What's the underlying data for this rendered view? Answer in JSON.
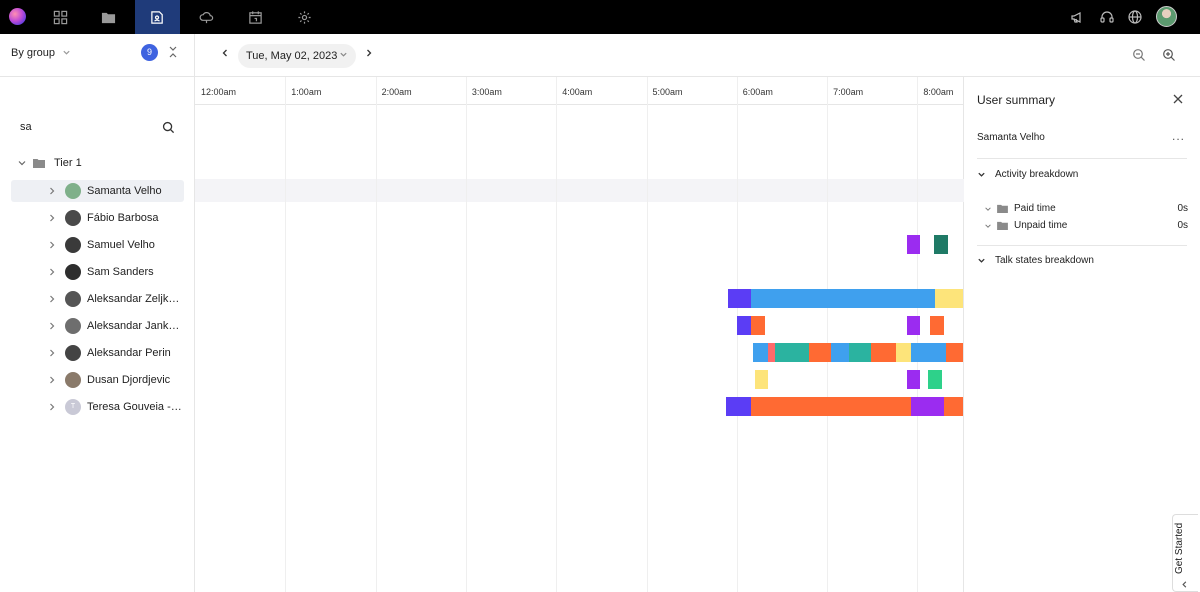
{
  "nav": {
    "items": [
      "dashboard-icon",
      "folder-icon",
      "people-icon",
      "cloud-icon",
      "calendar-icon",
      "settings-icon"
    ],
    "active_index": 2,
    "right_icons": [
      "megaphone-icon",
      "headset-icon",
      "globe-icon"
    ]
  },
  "toolbar": {
    "date": "Tue, May 02, 2023"
  },
  "left": {
    "group_by": "By group",
    "count": "9",
    "search_value": "sa",
    "tier": "Tier 1",
    "users": [
      {
        "name": "Samanta Velho",
        "avatar_color": "#7fb08a",
        "initial": ""
      },
      {
        "name": "Fábio Barbosa",
        "avatar_color": "#4a4a4a",
        "initial": ""
      },
      {
        "name": "Samuel Velho",
        "avatar_color": "#3a3a3a",
        "initial": ""
      },
      {
        "name": "Sam Sanders",
        "avatar_color": "#2e2e2e",
        "initial": ""
      },
      {
        "name": "Aleksandar Zeljko...",
        "avatar_color": "#555555",
        "initial": ""
      },
      {
        "name": "Aleksandar Janko...",
        "avatar_color": "#6e6e6e",
        "initial": ""
      },
      {
        "name": "Aleksandar Perin",
        "avatar_color": "#444444",
        "initial": ""
      },
      {
        "name": "Dusan Djordjevic",
        "avatar_color": "#8a7a6a",
        "initial": ""
      },
      {
        "name": "Teresa Gouveia - ...",
        "avatar_color": "#c9c9d6",
        "initial": "T"
      }
    ]
  },
  "timeline": {
    "hours": [
      "12:00am",
      "1:00am",
      "2:00am",
      "3:00am",
      "4:00am",
      "5:00am",
      "6:00am",
      "7:00am",
      "8:00am"
    ],
    "start_hour": 0,
    "end_hour": 8.5,
    "rows": [
      [],
      [],
      [
        {
          "start": 7.88,
          "end": 8.03,
          "color": "#9b2cf0"
        },
        {
          "start": 8.18,
          "end": 8.34,
          "color": "#1f7a66"
        }
      ],
      [],
      [
        {
          "start": 5.9,
          "end": 6.16,
          "color": "#5b3df5"
        },
        {
          "start": 6.16,
          "end": 8.2,
          "color": "#3fa0ee"
        },
        {
          "start": 8.2,
          "end": 8.5,
          "color": "#fde47a"
        }
      ],
      [
        {
          "start": 6.0,
          "end": 6.16,
          "color": "#5b3df5"
        },
        {
          "start": 6.16,
          "end": 6.31,
          "color": "#ff6a33"
        },
        {
          "start": 7.88,
          "end": 8.03,
          "color": "#9b2cf0"
        },
        {
          "start": 8.14,
          "end": 8.3,
          "color": "#ff6a33"
        }
      ],
      [
        {
          "start": 6.18,
          "end": 6.35,
          "color": "#3fa0ee"
        },
        {
          "start": 6.35,
          "end": 6.42,
          "color": "#ff6a6a"
        },
        {
          "start": 6.42,
          "end": 6.8,
          "color": "#2bb3a0"
        },
        {
          "start": 6.8,
          "end": 7.04,
          "color": "#ff6a33"
        },
        {
          "start": 7.04,
          "end": 7.24,
          "color": "#3fa0ee"
        },
        {
          "start": 7.24,
          "end": 7.49,
          "color": "#2bb3a0"
        },
        {
          "start": 7.49,
          "end": 7.76,
          "color": "#ff6a33"
        },
        {
          "start": 7.76,
          "end": 7.93,
          "color": "#fde47a"
        },
        {
          "start": 7.93,
          "end": 8.32,
          "color": "#3fa0ee"
        },
        {
          "start": 8.32,
          "end": 8.5,
          "color": "#ff6a33"
        }
      ],
      [
        {
          "start": 6.2,
          "end": 6.35,
          "color": "#fde47a"
        },
        {
          "start": 7.88,
          "end": 8.03,
          "color": "#9b2cf0"
        },
        {
          "start": 8.12,
          "end": 8.27,
          "color": "#2ed18a"
        }
      ],
      [
        {
          "start": 5.88,
          "end": 6.16,
          "color": "#5b3df5"
        },
        {
          "start": 6.16,
          "end": 7.93,
          "color": "#ff6a33"
        },
        {
          "start": 7.93,
          "end": 8.3,
          "color": "#9b2cf0"
        },
        {
          "start": 8.3,
          "end": 8.5,
          "color": "#ff6a33"
        }
      ]
    ]
  },
  "summary": {
    "title": "User summary",
    "user": "Samanta Velho",
    "more": "...",
    "activity_label": "Activity breakdown",
    "paid_label": "Paid time",
    "paid_value": "0s",
    "unpaid_label": "Unpaid time",
    "unpaid_value": "0s",
    "talk_label": "Talk states breakdown"
  },
  "get_started": "Get Started"
}
